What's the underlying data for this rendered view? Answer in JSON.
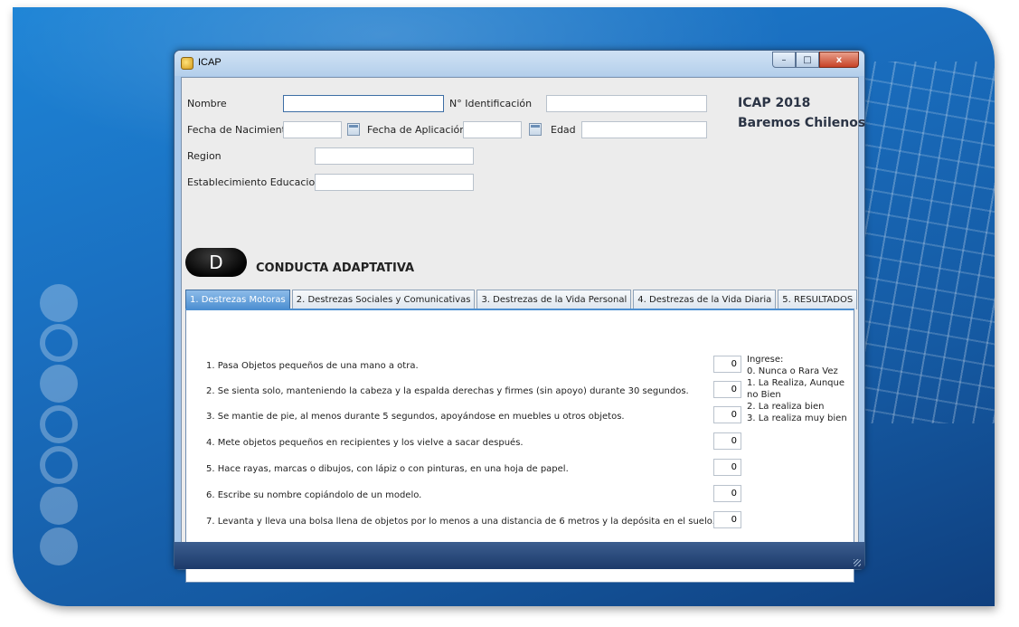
{
  "window": {
    "title": "ICAP",
    "min_label": "–",
    "max_label": "□",
    "close_label": "x"
  },
  "form": {
    "nombre_label": "Nombre",
    "nombre_value": "",
    "identificacion_label": "N° Identificación",
    "identificacion_value": "",
    "fecha_nacimiento_label": "Fecha de Nacimiento",
    "fecha_nacimiento_value": "",
    "fecha_aplicacion_label": "Fecha de Aplicación",
    "fecha_aplicacion_value": "",
    "edad_label": "Edad",
    "edad_value": "",
    "region_label": "Region",
    "region_value": "",
    "establecimiento_label": "Establecimiento Educacional",
    "establecimiento_value": ""
  },
  "brand": {
    "line1": "ICAP 2018",
    "line2": "Baremos Chilenos"
  },
  "section": {
    "badge": "D",
    "title": "CONDUCTA ADAPTATIVA"
  },
  "tabs": [
    {
      "label": "1. Destrezas Motoras",
      "active": true
    },
    {
      "label": "2. Destrezas Sociales y Comunicativas",
      "active": false
    },
    {
      "label": "3. Destrezas de la Vida Personal",
      "active": false
    },
    {
      "label": "4. Destrezas de la Vida Diaria",
      "active": false
    },
    {
      "label": "5. RESULTADOS",
      "active": false
    }
  ],
  "questions": [
    {
      "text": "1. Pasa Objetos pequeños de una mano a otra.",
      "value": "0"
    },
    {
      "text": "2. Se sienta solo, manteniendo la cabeza y la espalda derechas y firmes (sin apoyo) durante 30 segundos.",
      "value": "0"
    },
    {
      "text": "3. Se mantie de pie, al menos durante 5 segundos, apoyándose en muebles u otros objetos.",
      "value": "0"
    },
    {
      "text": "4. Mete objetos pequeños en recipientes y los vielve a sacar después.",
      "value": "0"
    },
    {
      "text": "5. Hace rayas, marcas o dibujos, con lápiz o con pinturas, en una hoja de papel.",
      "value": "0"
    },
    {
      "text": "6. Escribe su nombre copiándolo de un modelo.",
      "value": "0"
    },
    {
      "text": "7. Levanta y lleva una bolsa llena de objetos por lo menos a una distancia de 6 metros y la depósita en el suelo.",
      "value": "0"
    }
  ],
  "legend": {
    "title": "Ingrese:",
    "items": [
      "0. Nunca o Rara Vez",
      "1. La Realiza, Aunque no Bien",
      "2. La realiza bien",
      "3. La realiza muy bien"
    ]
  },
  "colors": {
    "active_tab": "#4c8fd1",
    "background": "#1a6fc0"
  }
}
